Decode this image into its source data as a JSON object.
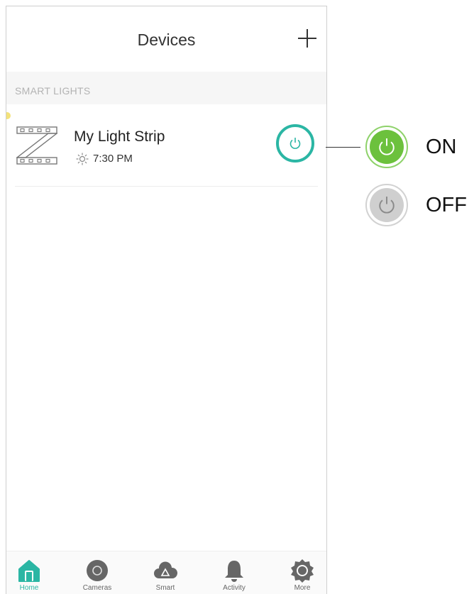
{
  "header": {
    "title": "Devices"
  },
  "section": {
    "label": "SMART LIGHTS"
  },
  "devices": [
    {
      "name": "My Light Strip",
      "schedule_time": "7:30 PM",
      "icon": "light-strip-icon",
      "state": "on"
    }
  ],
  "tabs": [
    {
      "label": "Home",
      "icon": "home-icon",
      "active": true
    },
    {
      "label": "Cameras",
      "icon": "camera-icon",
      "active": false
    },
    {
      "label": "Smart",
      "icon": "cloud-icon",
      "active": false
    },
    {
      "label": "Activity",
      "icon": "bell-icon",
      "active": false
    },
    {
      "label": "More",
      "icon": "gear-icon",
      "active": false
    }
  ],
  "legend": {
    "on_label": "ON",
    "off_label": "OFF"
  },
  "colors": {
    "accent": "#2bb6a4",
    "on": "#6cc13d",
    "off": "#cfcfcf"
  }
}
